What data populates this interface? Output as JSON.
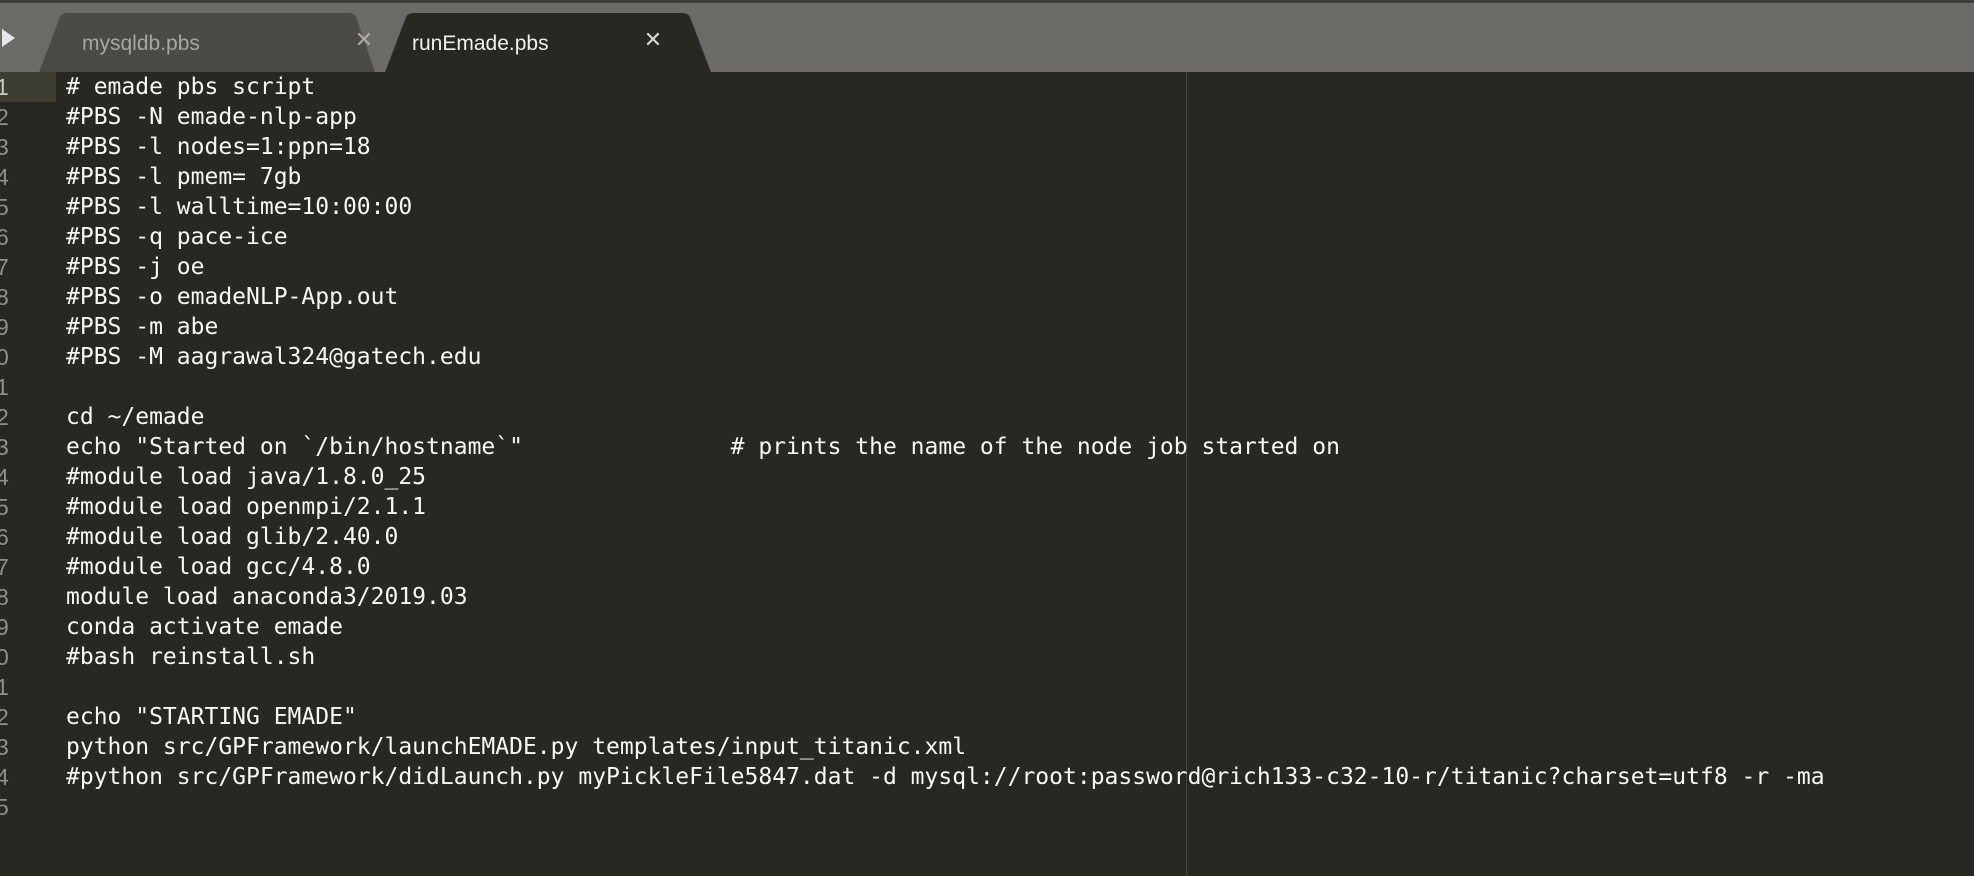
{
  "tabs": [
    {
      "label": "mysqldb.pbs",
      "active": false,
      "close_glyph": "✕"
    },
    {
      "label": "runEmade.pbs",
      "active": true,
      "close_glyph": "✕"
    }
  ],
  "colors": {
    "editor_background": "#272822",
    "tabbar_background": "#6b6a66",
    "active_tab": "#272822",
    "inactive_tab": "#4a4a46",
    "text": "#f8f8f2",
    "line_number": "#8f908a"
  },
  "icons": {
    "sidebar_toggle": "triangle-right-icon",
    "tab_close": "close-icon"
  },
  "editor": {
    "line_numbers": [
      "1",
      "2",
      "3",
      "4",
      "5",
      "6",
      "7",
      "8",
      "9",
      "0",
      "1",
      "2",
      "3",
      "4",
      "5",
      "6",
      "7",
      "8",
      "9",
      "0",
      "1",
      "2",
      "3",
      "4",
      "5"
    ],
    "lines": [
      "# emade pbs script",
      "#PBS -N emade-nlp-app",
      "#PBS -l nodes=1:ppn=18",
      "#PBS -l pmem= 7gb",
      "#PBS -l walltime=10:00:00",
      "#PBS -q pace-ice",
      "#PBS -j oe",
      "#PBS -o emadeNLP-App.out",
      "#PBS -m abe",
      "#PBS -M aagrawal324@gatech.edu",
      "",
      "cd ~/emade",
      "echo \"Started on `/bin/hostname`\"               # prints the name of the node job started on",
      "#module load java/1.8.0_25",
      "#module load openmpi/2.1.1",
      "#module load glib/2.40.0",
      "#module load gcc/4.8.0",
      "module load anaconda3/2019.03",
      "conda activate emade",
      "#bash reinstall.sh",
      "",
      "echo \"STARTING EMADE\"",
      "python src/GPFramework/launchEMADE.py templates/input_titanic.xml",
      "#python src/GPFramework/didLaunch.py myPickleFile5847.dat -d mysql://root:password@rich133-c32-10-r/titanic?charset=utf8 -r -ma",
      ""
    ]
  }
}
